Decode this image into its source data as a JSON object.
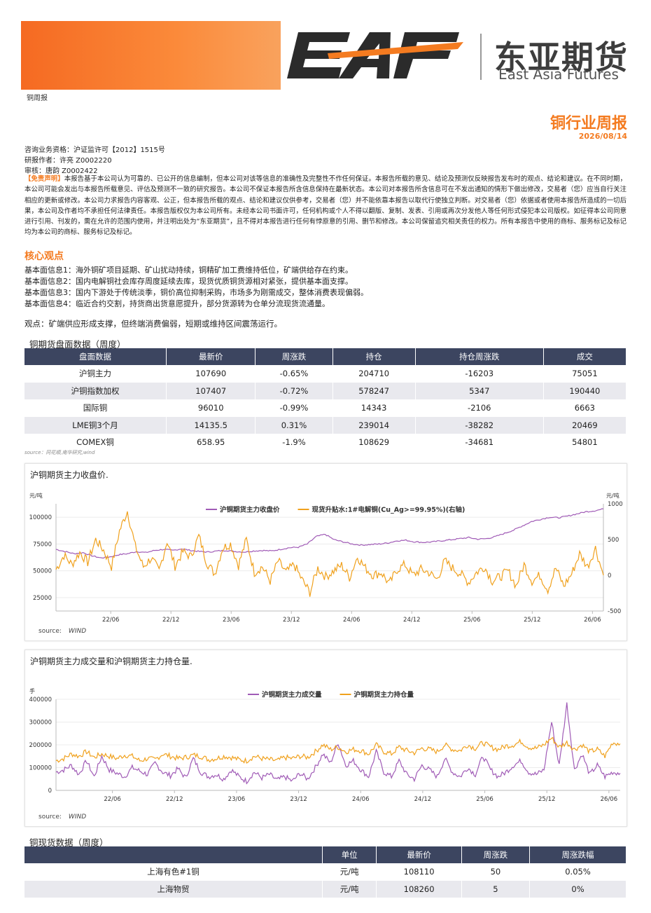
{
  "header": {
    "brand_letters": "EAF",
    "brand_cn": "东亚期货",
    "brand_en": "East Asia Futures",
    "doc_type": "铜周报",
    "report_title": "铜行业周报",
    "report_date": "2026/08/14"
  },
  "meta": {
    "license": "咨询业务资格：沪证监许可【2012】1515号",
    "author": "研报作者：许亮 Z0002220",
    "reviewer": "审核：唐韵 Z0002422"
  },
  "disclaimer": {
    "tag": "【免责声明】",
    "text": "本报告基于本公司认为可靠的、已公开的信息编制，但本公司对该等信息的准确性及完整性不作任何保证。本报告所载的意见、结论及预测仅反映报告发布时的观点、结论和建议。在不同时期，本公司可能会发出与本报告所载意见、评估及预测不一致的研究报告。本公司不保证本报告所含信息保持在最新状态。本公司对本报告所含信息可在不发出通知的情形下做出修改，交易者（您）应当自行关注相应的更新或修改。本公司力求报告内容客观、公正，但本报告所载的观点、结论和建议仅供参考，交易者（您）并不能依靠本报告以取代行使独立判断。对交易者（您）依据或者使用本报告所造成的一切后果，本公司及作者均不承担任何法律责任。本报告版权仅为本公司所有。未经本公司书面许可，任何机构或个人不得以翻版、复制、发表、引用或再次分发他人等任何形式侵犯本公司版权。如征得本公司同意进行引用、刊发的，需在允许的范围内使用，并注明出处为“东亚期货”，且不得对本报告进行任何有悖原意的引用、删节和修改。本公司保留追究相关责任的权力。所有本报告中使用的商标、服务标记及标记均为本公司的商标、服务标记及标记。"
  },
  "core": {
    "heading": "核心观点",
    "items": [
      "基本面信息1：海外铜矿项目延期、矿山扰动持续，铜精矿加工费维持低位，矿端供给存在约束。",
      "基本面信息2：国内电解铜社会库存周度延续去库，现货优质铜货源相对紧张，提供基本面支撑。",
      "基本面信息3：国内下游处于传统淡季，铜价高位抑制采购，市场多为刚需成交，整体消费表现偏弱。",
      "基本面信息4：临近合约交割，持货商出货意愿提升，部分货源转为仓单分流现货流通量。"
    ],
    "opinion": "观点：矿端供应形成支撑，但终端消费偏弱，短期或维持区间震荡运行。"
  },
  "futures_table": {
    "title": "铜期货盘面数据（周度）",
    "headers": [
      "盘面数据",
      "最新价",
      "周涨跌",
      "持仓",
      "持仓周涨跌",
      "成交"
    ],
    "rows": [
      [
        "沪铜主力",
        "107690",
        "-0.65%",
        "204710",
        "-16203",
        "75051"
      ],
      [
        "沪铜指数加权",
        "107407",
        "-0.72%",
        "578247",
        "5347",
        "190440"
      ],
      [
        "国际铜",
        "96010",
        "-0.99%",
        "14343",
        "-2106",
        "6663"
      ],
      [
        "LME铜3个月",
        "14135.5",
        "0.31%",
        "239014",
        "-38282",
        "20469"
      ],
      [
        "COMEX铜",
        "658.95",
        "-1.9%",
        "108629",
        "-34681",
        "54801"
      ]
    ],
    "source": "source：同花顺,南华研究,wind"
  },
  "chart1": {
    "title": "沪铜期货主力收盘价.",
    "source_label": "source:",
    "source_value": "WIND",
    "chart_data": {
      "type": "line",
      "x_ticks": [
        "22/06",
        "22/12",
        "23/06",
        "23/12",
        "24/06",
        "24/12",
        "25/06",
        "25/12",
        "26/06"
      ],
      "y_left_unit": "元/吨",
      "y_left_ticks": [
        "100000",
        "75000",
        "50000",
        "25000"
      ],
      "y_left_lim": [
        12500,
        112500
      ],
      "y_right_unit": "元/吨",
      "y_right_ticks": [
        "1000",
        "500",
        "0",
        "-500"
      ],
      "y_right_lim": [
        -500,
        1000
      ],
      "series": [
        {
          "name": "沪铜期货主力收盘价",
          "color": "#a05bb6",
          "axis": "left",
          "values": [
            70000,
            68000,
            66000,
            67000,
            64000,
            62000,
            63000,
            65000,
            66000,
            68000,
            67000,
            69000,
            70000,
            69000,
            70500,
            69000,
            68000,
            67500,
            68500,
            69000,
            68000,
            67500,
            68500,
            69000,
            68500,
            70000,
            71500,
            72000,
            75000,
            82000,
            84000,
            79000,
            77000,
            75000,
            74000,
            74500,
            75000,
            76000,
            78000,
            78500,
            77000,
            76500,
            77000,
            78000,
            79000,
            80000,
            81000,
            79500,
            80000,
            82000,
            85000,
            88000,
            92000,
            96000,
            98000,
            100000,
            99500,
            101000,
            103000,
            105000,
            106000,
            107690
          ]
        },
        {
          "name": "现货升贴水:1#电解铜(Cu_Ag>=99.95%)(右轴)",
          "color": "#f0a11d",
          "axis": "right",
          "values": [
            80,
            280,
            150,
            320,
            180,
            500,
            350,
            120,
            620,
            900,
            400,
            120,
            240,
            60,
            480,
            130,
            330,
            260,
            550,
            180,
            20,
            380,
            440,
            140,
            500,
            40,
            120,
            -80,
            200,
            40,
            150,
            -60,
            -240,
            100,
            -20,
            60,
            140,
            -30,
            260,
            100,
            0,
            40,
            -120,
            80,
            150,
            0,
            80,
            40,
            -60,
            200,
            100,
            20,
            -100,
            40,
            120,
            -80,
            -20,
            60,
            -150,
            150,
            -80,
            0,
            -200,
            100,
            -150,
            20,
            300,
            120,
            380,
            0
          ]
        }
      ]
    }
  },
  "chart2": {
    "title": "沪铜期货主力成交量和沪铜期货主力持仓量.",
    "source_label": "source:",
    "source_value": "WIND",
    "chart_data": {
      "type": "line",
      "x_ticks": [
        "22/06",
        "22/12",
        "23/06",
        "23/12",
        "24/06",
        "24/12",
        "25/06",
        "25/12",
        "26/06"
      ],
      "y_unit": "手",
      "y_ticks": [
        "400000",
        "300000",
        "200000",
        "100000",
        "0"
      ],
      "y_lim": [
        0,
        400000
      ],
      "series": [
        {
          "name": "沪铜期货主力成交量",
          "color": "#a05bb6",
          "values": [
            80000,
            90000,
            110000,
            70000,
            130000,
            60000,
            150000,
            90000,
            75000,
            60000,
            100000,
            85000,
            70000,
            120000,
            80000,
            65000,
            95000,
            55000,
            140000,
            80000,
            60000,
            70000,
            50000,
            90000,
            60000,
            40000,
            80000,
            55000,
            70000,
            45000,
            60000,
            40000,
            75000,
            50000,
            100000,
            160000,
            120000,
            210000,
            110000,
            130000,
            90000,
            60000,
            170000,
            80000,
            60000,
            130000,
            70000,
            50000,
            110000,
            90000,
            60000,
            140000,
            80000,
            60000,
            100000,
            70000,
            150000,
            90000,
            60000,
            80000,
            110000,
            130000,
            80000,
            70000,
            90000,
            300000,
            110000,
            380000,
            90000,
            160000,
            70000,
            110000,
            60000,
            80000,
            75051
          ]
        },
        {
          "name": "沪铜期货主力持仓量",
          "color": "#f0a11d",
          "values": [
            130000,
            140000,
            160000,
            150000,
            170000,
            145000,
            160000,
            150000,
            140000,
            155000,
            150000,
            130000,
            140000,
            135000,
            160000,
            150000,
            140000,
            145000,
            155000,
            150000,
            135000,
            140000,
            150000,
            145000,
            135000,
            130000,
            150000,
            140000,
            135000,
            130000,
            145000,
            140000,
            150000,
            145000,
            170000,
            200000,
            180000,
            190000,
            170000,
            180000,
            175000,
            160000,
            200000,
            170000,
            160000,
            190000,
            175000,
            165000,
            185000,
            180000,
            170000,
            200000,
            180000,
            175000,
            200000,
            185000,
            210000,
            190000,
            180000,
            195000,
            200000,
            215000,
            190000,
            185000,
            200000,
            230000,
            190000,
            210000,
            180000,
            200000,
            170000,
            180000,
            150000,
            210000,
            204710
          ]
        }
      ]
    }
  },
  "spot_table": {
    "title": "铜现货数据（周度）",
    "headers": [
      "",
      "单位",
      "最新价",
      "周涨跌",
      "周涨跌幅"
    ],
    "rows": [
      [
        "上海有色#1铜",
        "元/吨",
        "108110",
        "50",
        "0.05%"
      ],
      [
        "上海物贸",
        "元/吨",
        "108260",
        "5",
        "0%"
      ]
    ]
  }
}
